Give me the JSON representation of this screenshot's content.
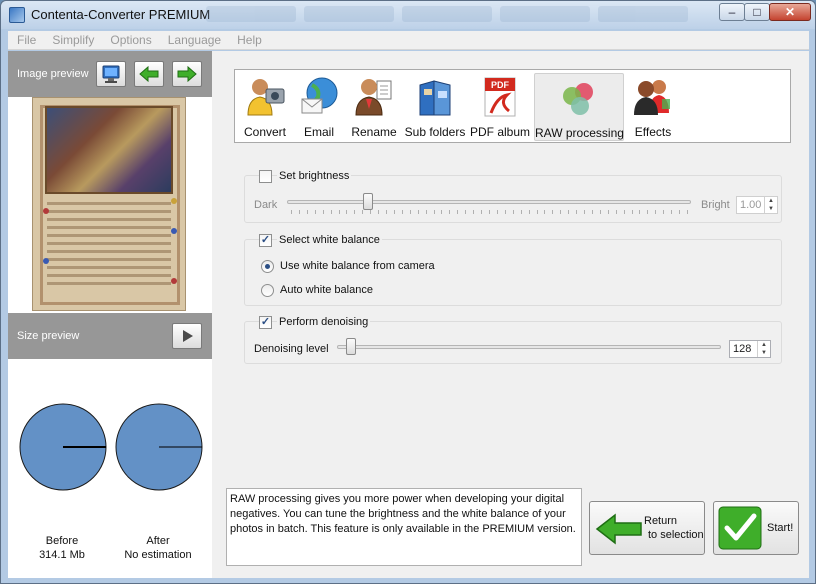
{
  "window": {
    "title": "Contenta-Converter PREMIUM",
    "controls": {
      "minimize": "–",
      "maximize": "□",
      "close": "✕"
    }
  },
  "menu": [
    "File",
    "Simplify",
    "Options",
    "Language",
    "Help"
  ],
  "left": {
    "image_preview_label": "Image preview",
    "size_preview_label": "Size preview",
    "before": {
      "label": "Before",
      "value": "314.1 Mb",
      "fraction": 0.25
    },
    "after": {
      "label": "After",
      "value": "No estimation",
      "fraction": 0.25
    },
    "pie_color": "#6391c6"
  },
  "toolbar": [
    {
      "label": "Convert",
      "icon": "convert-person-camera-icon"
    },
    {
      "label": "Email",
      "icon": "email-globe-icon"
    },
    {
      "label": "Rename",
      "icon": "rename-person-icon"
    },
    {
      "label": "Sub folders",
      "icon": "subfolders-icon"
    },
    {
      "label": "PDF album",
      "icon": "pdf-icon"
    },
    {
      "label": "RAW processing",
      "icon": "raw-spheres-icon",
      "selected": true
    },
    {
      "label": "Effects",
      "icon": "effects-people-icon"
    }
  ],
  "brightness": {
    "checkbox_label": "Set brightness",
    "checked": false,
    "dark_label": "Dark",
    "bright_label": "Bright",
    "value": "1.00",
    "position_fraction": 0.2
  },
  "white_balance": {
    "checkbox_label": "Select white balance",
    "checked": true,
    "options": [
      "Use white balance from camera",
      "Auto white balance"
    ],
    "selected_index": 0
  },
  "denoise": {
    "checkbox_label": "Perform denoising",
    "checked": true,
    "level_label": "Denoising level",
    "value": "128",
    "position_fraction": 0.02
  },
  "description": "RAW processing gives you more power when developing your digital negatives. You can tune the brightness and the white balance of your photos in batch. This feature is only available in the PREMIUM version.",
  "buttons": {
    "return_line1": "Return",
    "return_line2": "to selection",
    "start": "Start!"
  },
  "colors": {
    "accent_green": "#3fae2a",
    "header_gray": "#979797"
  }
}
